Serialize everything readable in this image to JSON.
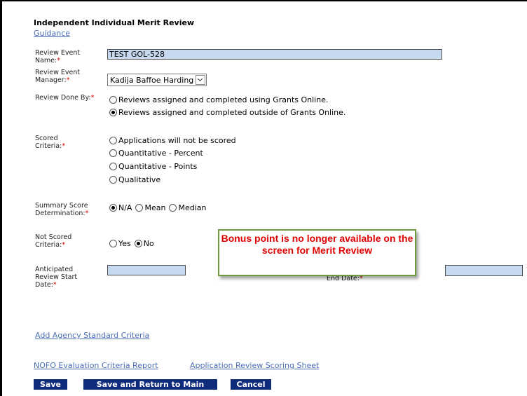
{
  "form": {
    "title": "Independent Individual Merit Review",
    "guidance_link": "Guidance",
    "review_event_name": {
      "label": "Review Event Name:",
      "required": "*",
      "value": "TEST GOL-528"
    },
    "review_event_manager": {
      "label": "Review Event Manager:",
      "required": "*",
      "selected": "Kadija Baffoe Harding"
    },
    "review_done_by": {
      "label": "Review Done By:",
      "required": "*",
      "options": [
        {
          "label": "Reviews assigned and completed using Grants Online.",
          "checked": false
        },
        {
          "label": "Reviews assigned and completed outside of Grants Online.",
          "checked": true
        }
      ]
    },
    "scored_criteria": {
      "label": "Scored Criteria:",
      "required": "*",
      "options": [
        {
          "label": "Applications will not be scored",
          "checked": false
        },
        {
          "label": "Quantitative - Percent",
          "checked": false
        },
        {
          "label": "Quantitative - Points",
          "checked": false
        },
        {
          "label": "Qualitative",
          "checked": false
        }
      ]
    },
    "summary_score": {
      "label": "Summary Score Determination:",
      "required": "*",
      "options": [
        {
          "label": "N/A",
          "checked": true
        },
        {
          "label": "Mean",
          "checked": false
        },
        {
          "label": "Median",
          "checked": false
        }
      ]
    },
    "not_scored_criteria": {
      "label": "Not Scored Criteria:",
      "required": "*",
      "options": [
        {
          "label": "Yes",
          "checked": false
        },
        {
          "label": "No",
          "checked": true
        }
      ]
    },
    "anticipated_start": {
      "label": "Anticipated Review Start Date:",
      "required": "*",
      "value": ""
    },
    "end_date": {
      "label": "End Date:",
      "required": "*",
      "value": ""
    }
  },
  "callout": {
    "text": "Bonus point is no longer available on the screen for Merit Review",
    "color": "#e00000",
    "border_color": "#6e9a3c"
  },
  "links": {
    "add_agency_criteria": "Add Agency Standard Criteria",
    "nofo_report": "NOFO Evaluation Criteria Report",
    "scoring_sheet": "Application Review Scoring Sheet"
  },
  "buttons": {
    "save": "Save",
    "save_return": "Save and Return to Main",
    "cancel": "Cancel",
    "color": "#0f2b7c"
  }
}
